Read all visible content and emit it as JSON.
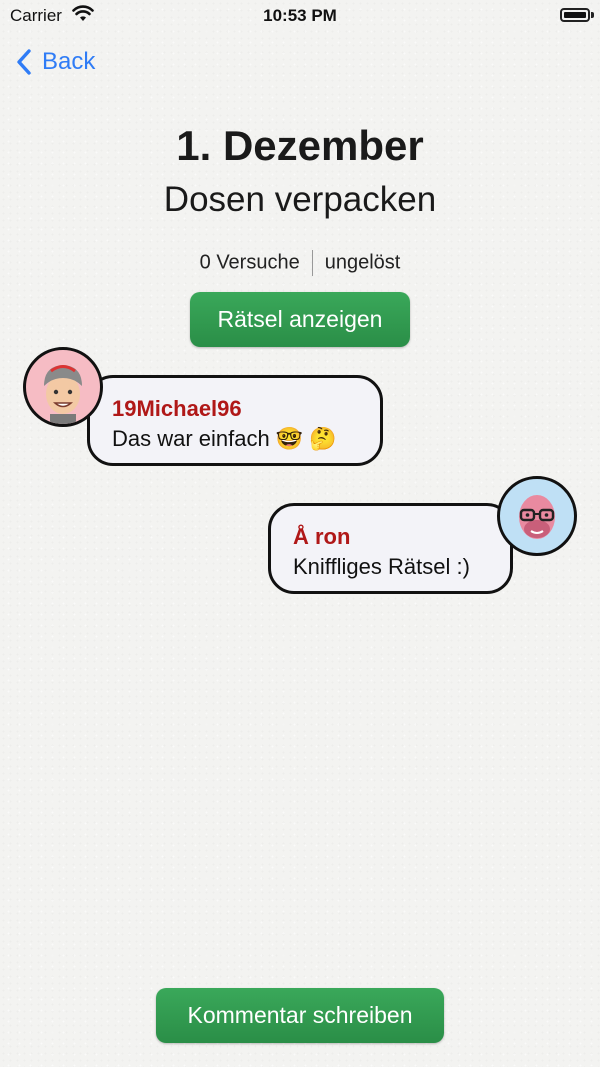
{
  "status_bar": {
    "carrier": "Carrier",
    "time": "10:53 PM"
  },
  "nav": {
    "back_label": "Back"
  },
  "header": {
    "title": "1. Dezember",
    "subtitle": "Dosen verpacken"
  },
  "stats": {
    "attempts": "0 Versuche",
    "state": "ungelöst"
  },
  "actions": {
    "show_puzzle": "Rätsel anzeigen",
    "write_comment": "Kommentar schreiben"
  },
  "comments": [
    {
      "author": "19Michael96",
      "text": "Das war einfach 🤓 🤔",
      "avatar": "memoji-man-cap"
    },
    {
      "author": "Å ron",
      "text": "Kniffliges Rätsel :)",
      "avatar": "memoji-pink-glasses"
    }
  ],
  "colors": {
    "accent": "#2f7cf6",
    "button_green": "#2f9a4e",
    "author_red": "#b01818"
  }
}
